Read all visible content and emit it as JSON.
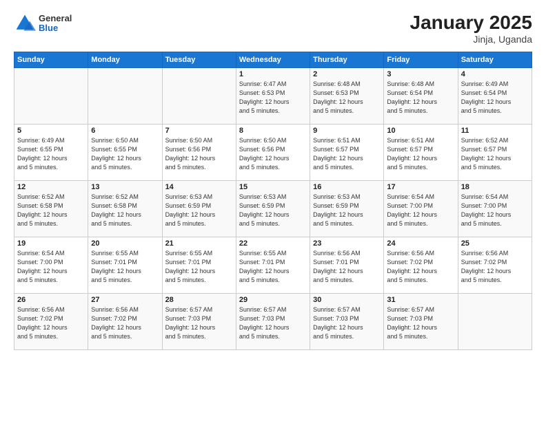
{
  "logo": {
    "line1": "General",
    "line2": "Blue"
  },
  "title": "January 2025",
  "subtitle": "Jinja, Uganda",
  "days_of_week": [
    "Sunday",
    "Monday",
    "Tuesday",
    "Wednesday",
    "Thursday",
    "Friday",
    "Saturday"
  ],
  "weeks": [
    [
      {
        "day": "",
        "info": ""
      },
      {
        "day": "",
        "info": ""
      },
      {
        "day": "",
        "info": ""
      },
      {
        "day": "1",
        "info": "Sunrise: 6:47 AM\nSunset: 6:53 PM\nDaylight: 12 hours\nand 5 minutes."
      },
      {
        "day": "2",
        "info": "Sunrise: 6:48 AM\nSunset: 6:53 PM\nDaylight: 12 hours\nand 5 minutes."
      },
      {
        "day": "3",
        "info": "Sunrise: 6:48 AM\nSunset: 6:54 PM\nDaylight: 12 hours\nand 5 minutes."
      },
      {
        "day": "4",
        "info": "Sunrise: 6:49 AM\nSunset: 6:54 PM\nDaylight: 12 hours\nand 5 minutes."
      }
    ],
    [
      {
        "day": "5",
        "info": "Sunrise: 6:49 AM\nSunset: 6:55 PM\nDaylight: 12 hours\nand 5 minutes."
      },
      {
        "day": "6",
        "info": "Sunrise: 6:50 AM\nSunset: 6:55 PM\nDaylight: 12 hours\nand 5 minutes."
      },
      {
        "day": "7",
        "info": "Sunrise: 6:50 AM\nSunset: 6:56 PM\nDaylight: 12 hours\nand 5 minutes."
      },
      {
        "day": "8",
        "info": "Sunrise: 6:50 AM\nSunset: 6:56 PM\nDaylight: 12 hours\nand 5 minutes."
      },
      {
        "day": "9",
        "info": "Sunrise: 6:51 AM\nSunset: 6:57 PM\nDaylight: 12 hours\nand 5 minutes."
      },
      {
        "day": "10",
        "info": "Sunrise: 6:51 AM\nSunset: 6:57 PM\nDaylight: 12 hours\nand 5 minutes."
      },
      {
        "day": "11",
        "info": "Sunrise: 6:52 AM\nSunset: 6:57 PM\nDaylight: 12 hours\nand 5 minutes."
      }
    ],
    [
      {
        "day": "12",
        "info": "Sunrise: 6:52 AM\nSunset: 6:58 PM\nDaylight: 12 hours\nand 5 minutes."
      },
      {
        "day": "13",
        "info": "Sunrise: 6:52 AM\nSunset: 6:58 PM\nDaylight: 12 hours\nand 5 minutes."
      },
      {
        "day": "14",
        "info": "Sunrise: 6:53 AM\nSunset: 6:59 PM\nDaylight: 12 hours\nand 5 minutes."
      },
      {
        "day": "15",
        "info": "Sunrise: 6:53 AM\nSunset: 6:59 PM\nDaylight: 12 hours\nand 5 minutes."
      },
      {
        "day": "16",
        "info": "Sunrise: 6:53 AM\nSunset: 6:59 PM\nDaylight: 12 hours\nand 5 minutes."
      },
      {
        "day": "17",
        "info": "Sunrise: 6:54 AM\nSunset: 7:00 PM\nDaylight: 12 hours\nand 5 minutes."
      },
      {
        "day": "18",
        "info": "Sunrise: 6:54 AM\nSunset: 7:00 PM\nDaylight: 12 hours\nand 5 minutes."
      }
    ],
    [
      {
        "day": "19",
        "info": "Sunrise: 6:54 AM\nSunset: 7:00 PM\nDaylight: 12 hours\nand 5 minutes."
      },
      {
        "day": "20",
        "info": "Sunrise: 6:55 AM\nSunset: 7:01 PM\nDaylight: 12 hours\nand 5 minutes."
      },
      {
        "day": "21",
        "info": "Sunrise: 6:55 AM\nSunset: 7:01 PM\nDaylight: 12 hours\nand 5 minutes."
      },
      {
        "day": "22",
        "info": "Sunrise: 6:55 AM\nSunset: 7:01 PM\nDaylight: 12 hours\nand 5 minutes."
      },
      {
        "day": "23",
        "info": "Sunrise: 6:56 AM\nSunset: 7:01 PM\nDaylight: 12 hours\nand 5 minutes."
      },
      {
        "day": "24",
        "info": "Sunrise: 6:56 AM\nSunset: 7:02 PM\nDaylight: 12 hours\nand 5 minutes."
      },
      {
        "day": "25",
        "info": "Sunrise: 6:56 AM\nSunset: 7:02 PM\nDaylight: 12 hours\nand 5 minutes."
      }
    ],
    [
      {
        "day": "26",
        "info": "Sunrise: 6:56 AM\nSunset: 7:02 PM\nDaylight: 12 hours\nand 5 minutes."
      },
      {
        "day": "27",
        "info": "Sunrise: 6:56 AM\nSunset: 7:02 PM\nDaylight: 12 hours\nand 5 minutes."
      },
      {
        "day": "28",
        "info": "Sunrise: 6:57 AM\nSunset: 7:03 PM\nDaylight: 12 hours\nand 5 minutes."
      },
      {
        "day": "29",
        "info": "Sunrise: 6:57 AM\nSunset: 7:03 PM\nDaylight: 12 hours\nand 5 minutes."
      },
      {
        "day": "30",
        "info": "Sunrise: 6:57 AM\nSunset: 7:03 PM\nDaylight: 12 hours\nand 5 minutes."
      },
      {
        "day": "31",
        "info": "Sunrise: 6:57 AM\nSunset: 7:03 PM\nDaylight: 12 hours\nand 5 minutes."
      },
      {
        "day": "",
        "info": ""
      }
    ]
  ]
}
